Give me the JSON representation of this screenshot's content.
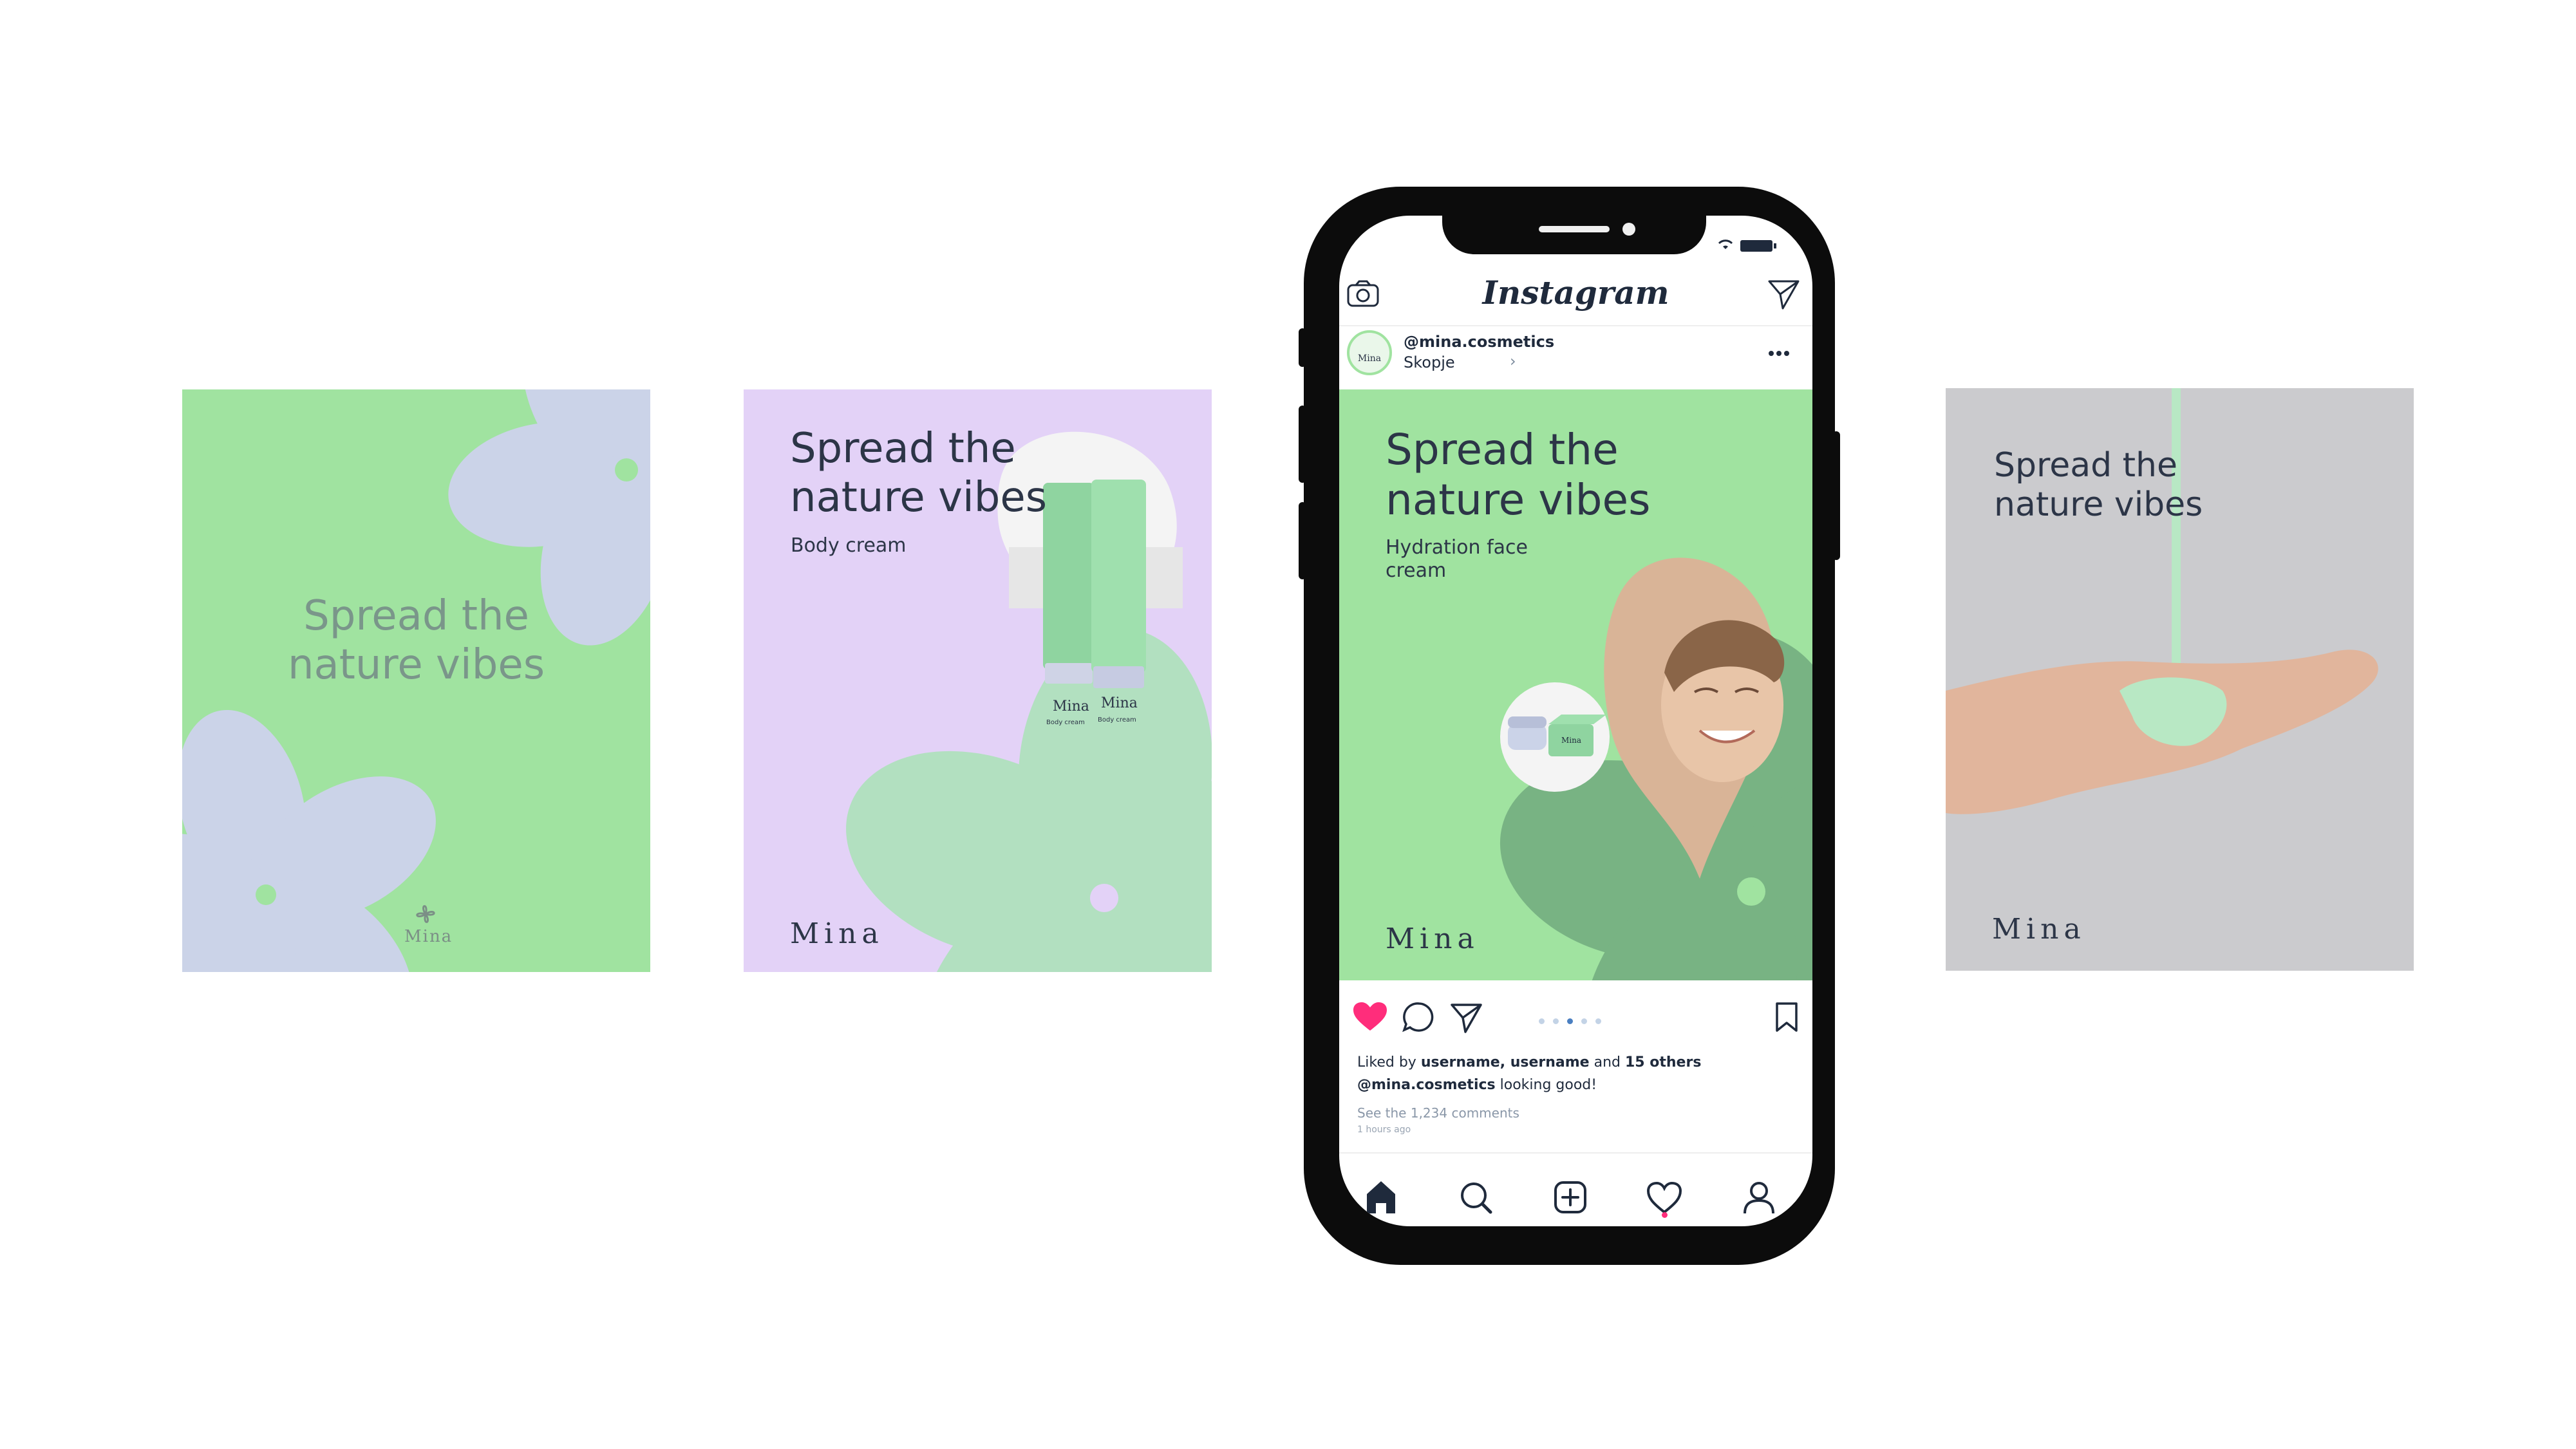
{
  "colors": {
    "green": "#a0e3a0",
    "dark_green": "#78b383",
    "lavender": "#e3d2f7",
    "petal_lavender": "#cbd3e8",
    "gray": "#cdcdd0",
    "mint": "#b2e0c0",
    "navy": "#2c3547",
    "heart": "#ff2d7b"
  },
  "card1": {
    "headline_1": "Spread the",
    "headline_2": "nature vibes",
    "logo_text": "Mina"
  },
  "card2": {
    "headline_1": "Spread the",
    "headline_2": "nature vibes",
    "subtitle": "Body cream",
    "logo_text": "Mina",
    "product_text": "Mina",
    "product_sub": "Body cream"
  },
  "card4": {
    "headline_1": "Spread the",
    "headline_2": "nature vibes",
    "logo_text": "Mina"
  },
  "instagram": {
    "brand": "Instagram",
    "icons": {
      "camera": "camera-icon",
      "direct": "send-icon",
      "more": "more-icon"
    },
    "profile": {
      "username": "@mina.cosmetics",
      "location": "Skopje",
      "location_arrow": "›",
      "avatar_text": "Mina"
    },
    "post": {
      "headline_1": "Spread the",
      "headline_2": "nature vibes",
      "subtitle_1": "Hydration face",
      "subtitle_2": "cream",
      "logo_text": "Mina",
      "jar_text": "Mina"
    },
    "actions": {
      "likes_prefix": "Liked by",
      "likes_users": "username, username",
      "likes_and": "and",
      "likes_others": "15 others"
    },
    "caption": {
      "user": "@mina.cosmetics",
      "text": "looking good!"
    },
    "comments_link": "See the 1,234 comments",
    "time": "1 hours ago",
    "carousel": {
      "count": 5,
      "active": 2
    }
  }
}
